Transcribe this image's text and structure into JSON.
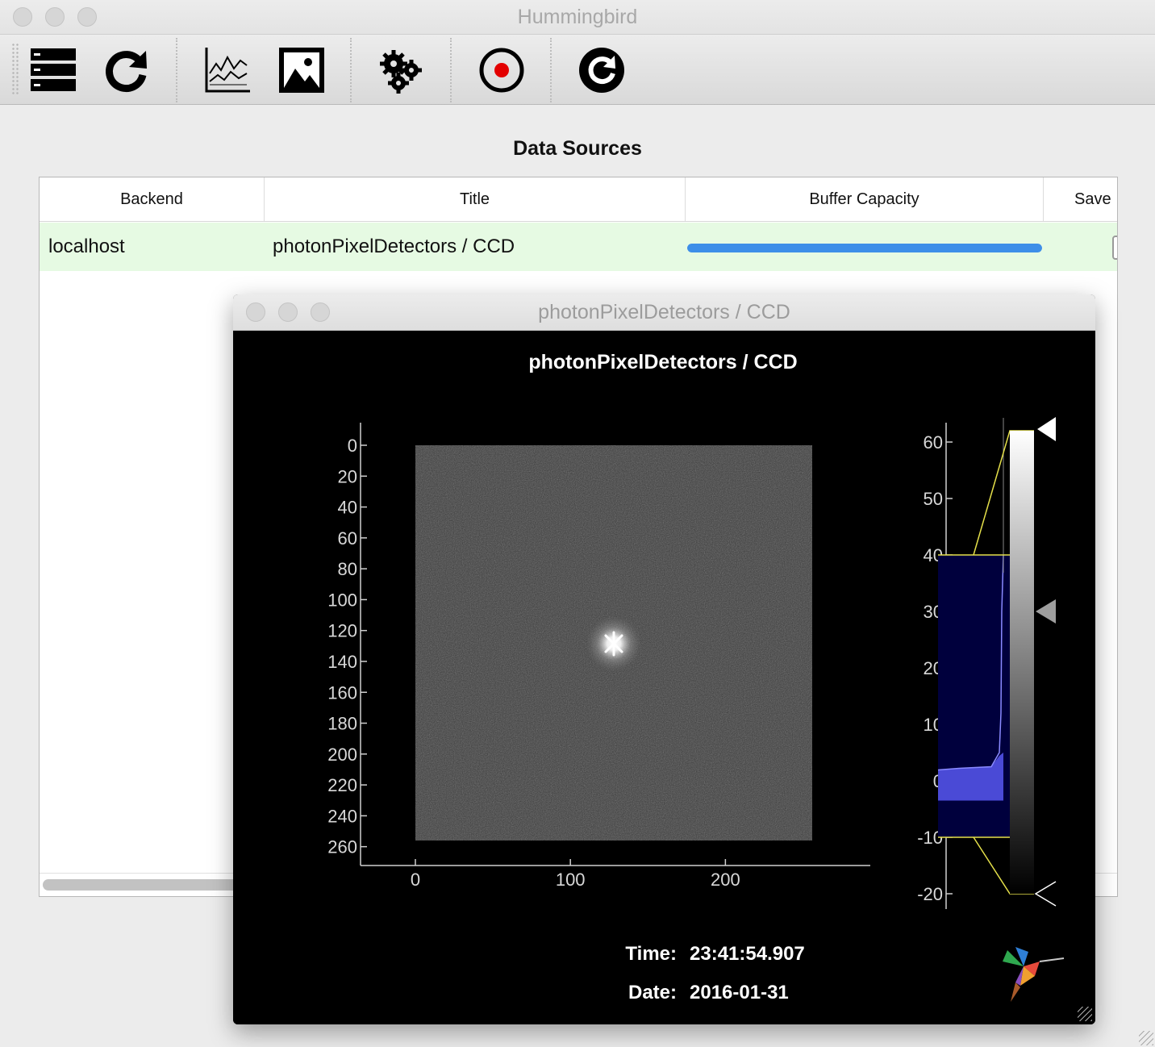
{
  "app": {
    "title": "Hummingbird"
  },
  "toolbar": {
    "buttons": [
      {
        "name": "data-sources-icon"
      },
      {
        "name": "reload-icon"
      },
      {
        "name": "line-plot-icon"
      },
      {
        "name": "image-plot-icon"
      },
      {
        "name": "settings-icon"
      },
      {
        "name": "record-icon"
      },
      {
        "name": "restore-icon"
      }
    ]
  },
  "data_sources": {
    "heading": "Data Sources",
    "columns": [
      "Backend",
      "Title",
      "Buffer Capacity",
      "Save"
    ],
    "rows": [
      {
        "backend": "localhost",
        "title": "photonPixelDetectors / CCD",
        "buffer_fill": 1.0
      }
    ]
  },
  "viewer": {
    "window_title": "photonPixelDetectors / CCD",
    "plot_title": "photonPixelDetectors / CCD",
    "time_label": "Time:",
    "time_value": "23:41:54.907",
    "date_label": "Date:",
    "date_value": "2016-01-31"
  },
  "chart_data": {
    "type": "heatmap",
    "title": "photonPixelDetectors / CCD",
    "xlabel": "",
    "ylabel": "",
    "x_ticks": [
      "0",
      "100",
      "200"
    ],
    "y_ticks": [
      "0",
      "20",
      "40",
      "60",
      "80",
      "100",
      "120",
      "140",
      "160",
      "180",
      "200",
      "220",
      "240",
      "260"
    ],
    "xlim": [
      0,
      256
    ],
    "ylim": [
      0,
      256
    ],
    "description_peak": [
      128,
      128
    ],
    "colorbar": {
      "ticks": [
        "60",
        "50",
        "40",
        "30",
        "20",
        "10",
        "0",
        "-10",
        "-20"
      ],
      "range": [
        -20,
        60
      ],
      "level_min": -20,
      "level_max": 62,
      "histogram_region": [
        -10,
        40
      ],
      "colormap": "grayscale"
    },
    "colors": {
      "background": "#000000",
      "histogram_region": "#00003d",
      "histogram_fill": "#4a4ad6",
      "level_lines": "#e5e04a"
    }
  }
}
